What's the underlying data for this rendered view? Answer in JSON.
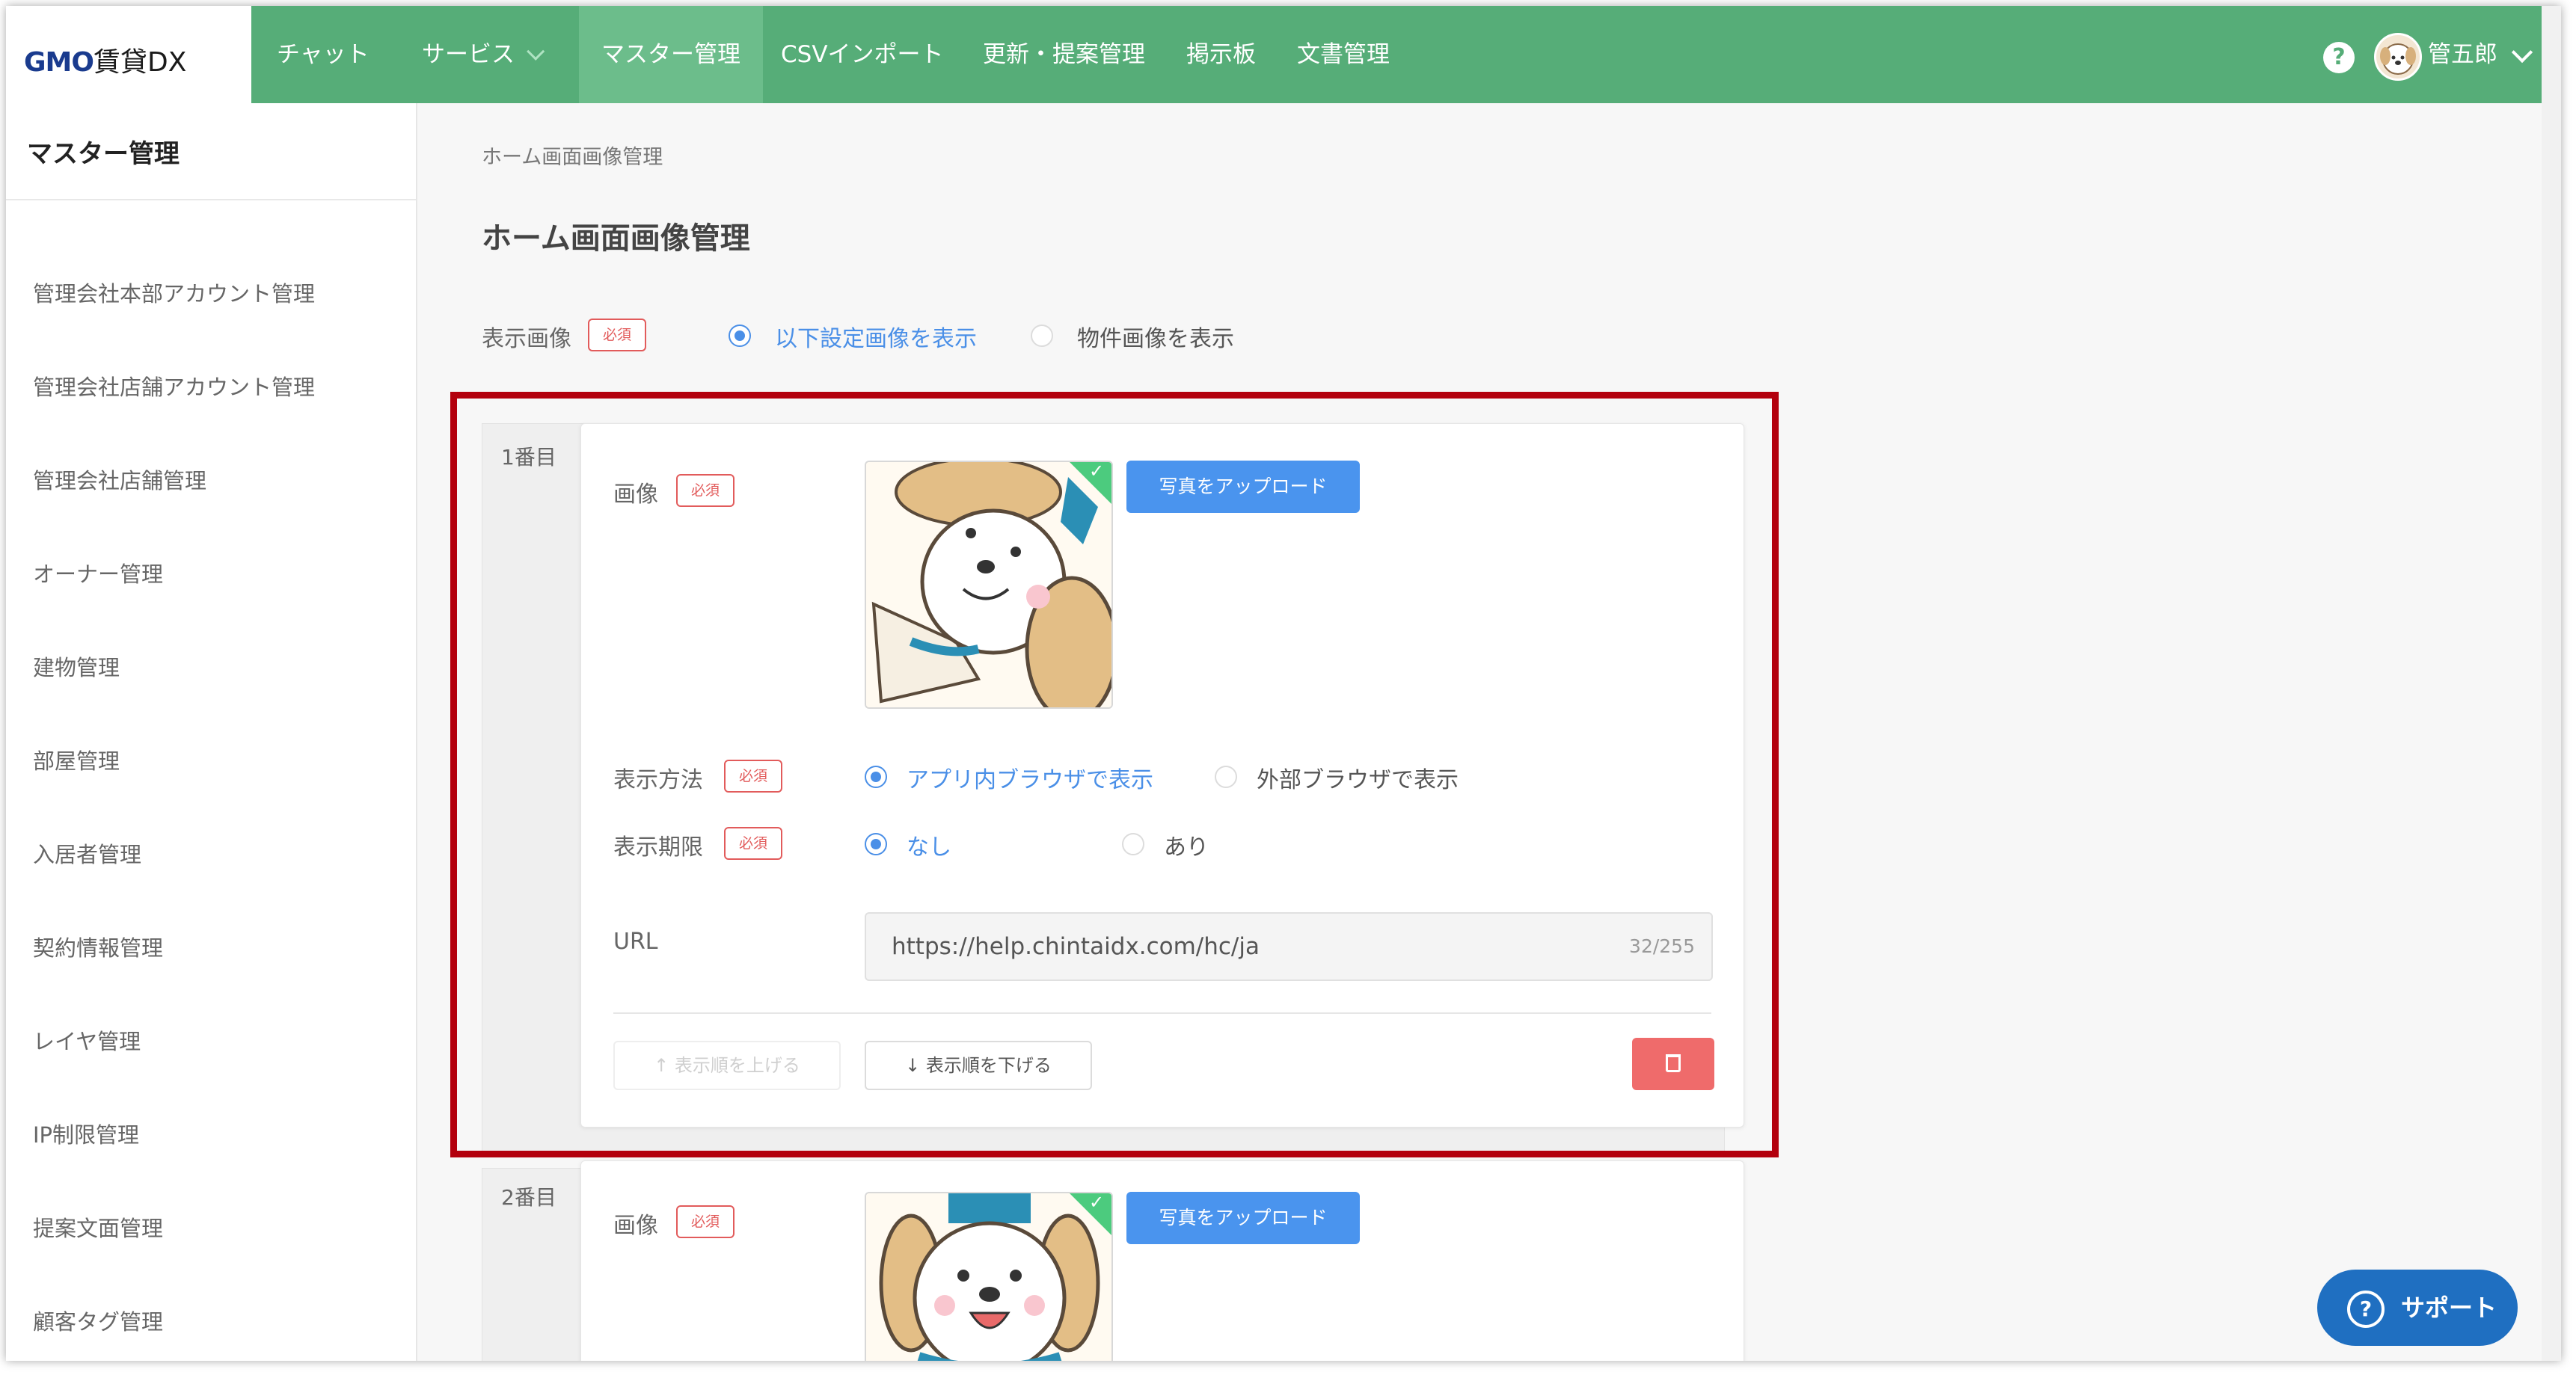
{
  "header": {
    "logo_brand": "GMO",
    "logo_product": "賃貸DX",
    "nav": [
      {
        "label": "チャット"
      },
      {
        "label": "サービス"
      },
      {
        "label": "マスター管理"
      },
      {
        "label": "CSVインポート"
      },
      {
        "label": "更新・提案管理"
      },
      {
        "label": "掲示板"
      },
      {
        "label": "文書管理"
      }
    ],
    "help_glyph": "?",
    "user_name": "管五郎"
  },
  "sidebar": {
    "title": "マスター管理",
    "items": [
      {
        "label": "管理会社本部アカウント管理"
      },
      {
        "label": "管理会社店舗アカウント管理"
      },
      {
        "label": "管理会社店舗管理"
      },
      {
        "label": "オーナー管理"
      },
      {
        "label": "建物管理"
      },
      {
        "label": "部屋管理"
      },
      {
        "label": "入居者管理"
      },
      {
        "label": "契約情報管理"
      },
      {
        "label": "レイヤ管理"
      },
      {
        "label": "IP制限管理"
      },
      {
        "label": "提案文面管理"
      },
      {
        "label": "顧客タグ管理"
      }
    ]
  },
  "main": {
    "breadcrumb": "ホーム画面画像管理",
    "title": "ホーム画面画像管理",
    "display_image": {
      "label": "表示画像",
      "required": "必須",
      "option_selected": "以下設定画像を表示",
      "option_other": "物件画像を表示"
    },
    "entries": [
      {
        "order": "1番目",
        "image_label": "画像",
        "required": "必須",
        "upload_label": "写真をアップロード",
        "display_method": {
          "label": "表示方法",
          "option_selected": "アプリ内ブラウザで表示",
          "option_other": "外部ブラウザで表示"
        },
        "display_period": {
          "label": "表示期限",
          "option_selected": "なし",
          "option_other": "あり"
        },
        "url_label": "URL",
        "url_value": "https://help.chintaidx.com/hc/ja",
        "url_count": "32/255",
        "move_up": "表示順を上げる",
        "move_down": "表示順を下げる"
      },
      {
        "order": "2番目",
        "image_label": "画像",
        "required": "必須",
        "upload_label": "写真をアップロード"
      }
    ]
  },
  "support": {
    "label": "サポート",
    "glyph": "?"
  },
  "colors": {
    "header_green": "#56ad78",
    "accent_blue": "#4a8fe7",
    "required_red": "#e25b5b",
    "delete_red": "#ef6b6b",
    "highlight_red": "#b3000d",
    "support_blue": "#1f6fc1"
  }
}
